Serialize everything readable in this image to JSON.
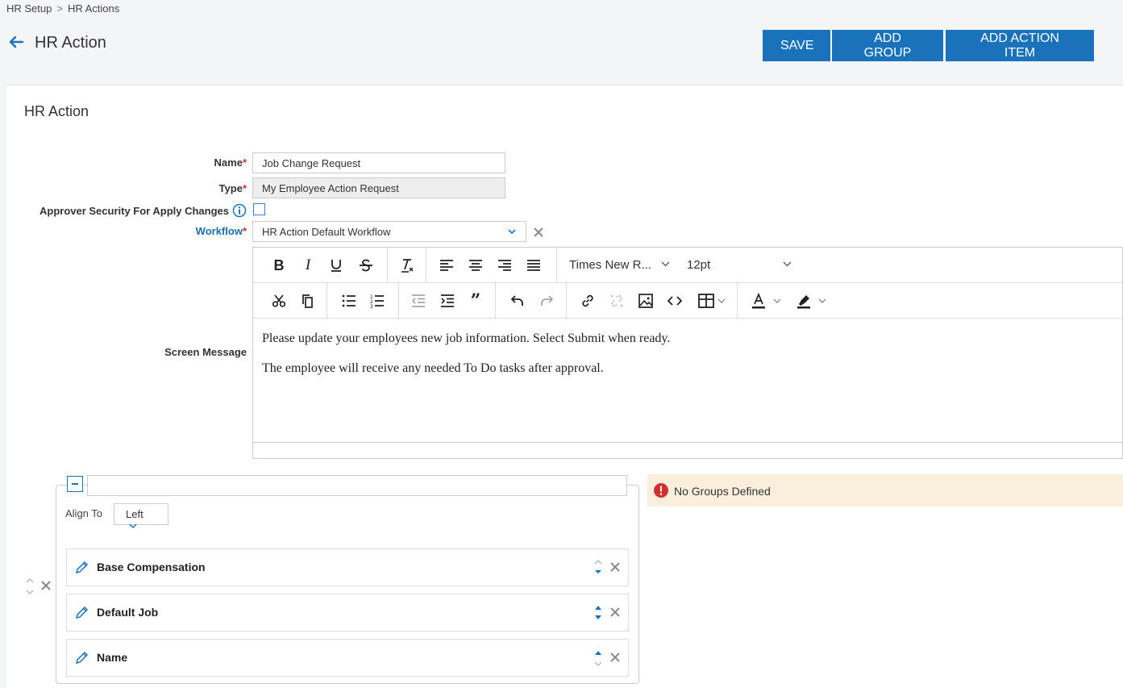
{
  "breadcrumb": {
    "items": [
      "HR Setup",
      "HR Actions"
    ],
    "separator": ">"
  },
  "header": {
    "title": "HR Action",
    "buttons": {
      "save": "SAVE",
      "add_group": "ADD GROUP",
      "add_action_item": "ADD ACTION ITEM"
    }
  },
  "card": {
    "title": "HR Action",
    "fields": {
      "name": {
        "label": "Name",
        "required_mark": "*",
        "value": "Job Change Request"
      },
      "type": {
        "label": "Type",
        "required_mark": "*",
        "value": "My Employee Action Request"
      },
      "approver_security": {
        "label": "Approver Security For Apply Changes",
        "checked": false
      },
      "workflow": {
        "label": "Workflow",
        "required_mark": "*",
        "value": "HR Action Default Workflow"
      },
      "screen_message": {
        "label": "Screen Message"
      }
    },
    "editor": {
      "font_family": "Times New R...",
      "font_size": "12pt",
      "content": [
        "Please update your employees new job information.  Select Submit when ready.",
        "The employee will receive any needed To Do tasks after approval."
      ]
    },
    "group": {
      "align_label": "Align To",
      "align_value": "Left",
      "items": [
        {
          "label": "Base Compensation"
        },
        {
          "label": "Default Job"
        },
        {
          "label": "Name"
        }
      ]
    },
    "alert": {
      "text": "No Groups Defined"
    }
  },
  "colors": {
    "primary": "#1a73ba",
    "required": "#c0392b",
    "link_label": "#1a6db3",
    "alert_bg": "#faefdc",
    "alert_icon": "#d32f2f"
  }
}
